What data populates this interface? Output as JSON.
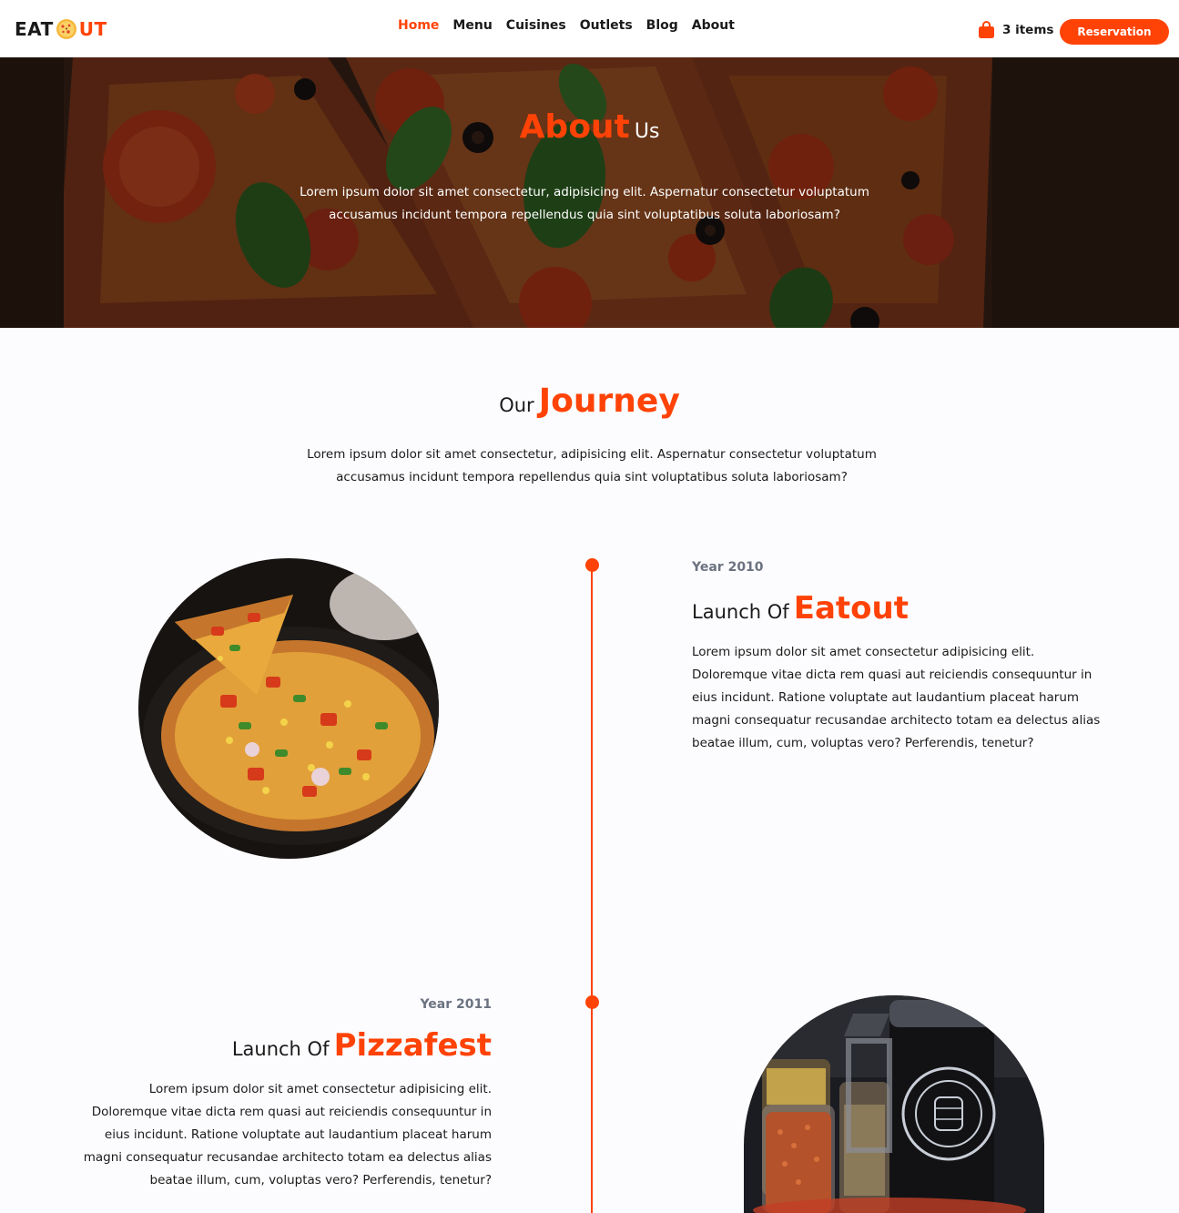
{
  "colors": {
    "accent": "#ff4307",
    "text": "#1a1a1a",
    "muted": "#6b7280",
    "background": "#fcfcfe"
  },
  "header": {
    "logo": {
      "left": "EAT",
      "right": "UT",
      "icon": "pizza-icon"
    },
    "nav": [
      {
        "label": "Home",
        "active": true
      },
      {
        "label": "Menu",
        "active": false
      },
      {
        "label": "Cuisines",
        "active": false
      },
      {
        "label": "Outlets",
        "active": false
      },
      {
        "label": "Blog",
        "active": false
      },
      {
        "label": "About",
        "active": false
      }
    ],
    "cart": {
      "label": "3 items",
      "icon": "shopping-bag-icon"
    },
    "reservation_label": "Reservation"
  },
  "hero": {
    "title_accent": "About",
    "title_plain": "Us",
    "text": "Lorem ipsum dolor sit amet consectetur, adipisicing elit. Aspernatur consectetur voluptatum accusamus incidunt tempora repellendus quia sint voluptatibus soluta laboriosam?"
  },
  "journey": {
    "title_plain": "Our",
    "title_accent": "Journey",
    "text": "Lorem ipsum dolor sit amet consectetur, adipisicing elit. Aspernatur consectetur voluptatum accusamus incidunt tempora repellendus quia sint voluptatibus soluta laboriosam?",
    "items": [
      {
        "year": "Year 2010",
        "title_plain": "Launch Of",
        "title_accent": "Eatout",
        "text": "Lorem ipsum dolor sit amet consectetur adipisicing elit. Doloremque vitae dicta rem quasi aut reiciendis consequuntur in eius incidunt. Ratione voluptate aut laudantium placeat harum magni consequatur recusandae architecto totam ea delectus alias beatae illum, cum, voluptas vero? Perferendis, tenetur?"
      },
      {
        "year": "Year 2011",
        "title_plain": "Launch Of",
        "title_accent": "Pizzafest",
        "text": "Lorem ipsum dolor sit amet consectetur adipisicing elit. Doloremque vitae dicta rem quasi aut reiciendis consequuntur in eius incidunt. Ratione voluptate aut laudantium placeat harum magni consequatur recusandae architecto totam ea delectus alias beatae illum, cum, voluptas vero? Perferendis, tenetur?"
      }
    ]
  }
}
